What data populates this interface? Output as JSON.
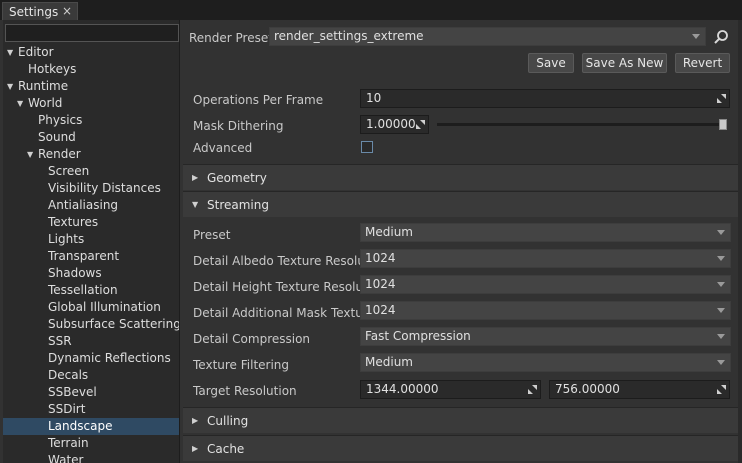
{
  "window": {
    "tab_title": "Settings",
    "tab_close": "×"
  },
  "tree": {
    "search_value": "",
    "items": [
      {
        "label": "Editor",
        "expanded": true
      },
      {
        "label": "Hotkeys"
      },
      {
        "label": "Runtime",
        "expanded": true
      },
      {
        "label": "World",
        "expanded": true
      },
      {
        "label": "Physics"
      },
      {
        "label": "Sound"
      },
      {
        "label": "Render",
        "expanded": true
      },
      {
        "label": "Screen"
      },
      {
        "label": "Visibility Distances"
      },
      {
        "label": "Antialiasing"
      },
      {
        "label": "Textures"
      },
      {
        "label": "Lights"
      },
      {
        "label": "Transparent"
      },
      {
        "label": "Shadows"
      },
      {
        "label": "Tessellation"
      },
      {
        "label": "Global Illumination"
      },
      {
        "label": "Subsurface Scattering"
      },
      {
        "label": "SSR"
      },
      {
        "label": "Dynamic Reflections"
      },
      {
        "label": "Decals"
      },
      {
        "label": "SSBevel"
      },
      {
        "label": "SSDirt"
      },
      {
        "label": "Landscape",
        "selected": true
      },
      {
        "label": "Terrain"
      },
      {
        "label": "Water"
      }
    ]
  },
  "preset": {
    "label": "Render Preset:",
    "value": "render_settings_extreme"
  },
  "buttons": {
    "save": "Save",
    "save_as_new": "Save As New",
    "revert": "Revert"
  },
  "general": {
    "ops_label": "Operations Per Frame",
    "ops_value": "10",
    "dither_label": "Mask Dithering",
    "dither_value": "1.00000",
    "dither_slider_fraction": 1.0,
    "advanced_label": "Advanced",
    "advanced_checked": false
  },
  "sections": {
    "geometry": "Geometry",
    "streaming": "Streaming",
    "culling": "Culling",
    "cache": "Cache"
  },
  "streaming": {
    "preset_label": "Preset",
    "preset_value": "Medium",
    "albedo_label": "Detail Albedo Texture Resolution",
    "albedo_value": "1024",
    "height_label": "Detail Height Texture Resolution",
    "height_value": "1024",
    "mask_label": "Detail Additional Mask Texture ...",
    "mask_value": "1024",
    "compression_label": "Detail Compression",
    "compression_value": "Fast Compression",
    "filtering_label": "Texture Filtering",
    "filtering_value": "Medium",
    "target_label": "Target Resolution",
    "target_x": "1344.00000",
    "target_y": "756.00000"
  },
  "colors": {
    "selection": "#2f4a63",
    "background": "#323232"
  }
}
